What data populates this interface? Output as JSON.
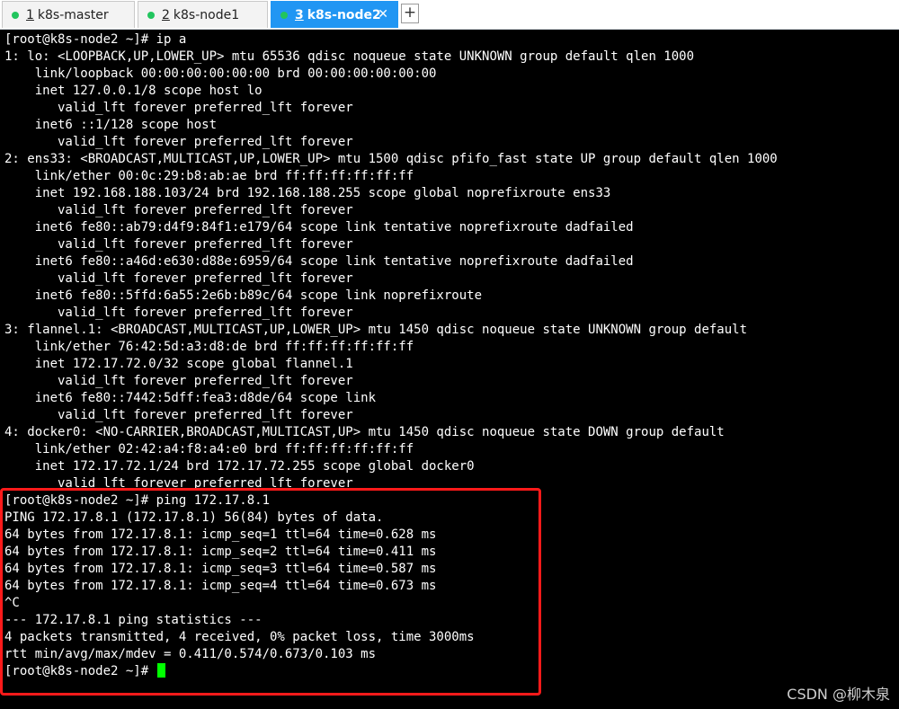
{
  "tabs": [
    {
      "number": "1",
      "label": "k8s-master",
      "active": false
    },
    {
      "number": "2",
      "label": "k8s-node1",
      "active": false
    },
    {
      "number": "3",
      "label": "k8s-node2",
      "active": true
    }
  ],
  "tab_close_glyph": "✕",
  "new_tab_glyph": "+",
  "terminal_lines": [
    "[root@k8s-node2 ~]# ip a",
    "1: lo: <LOOPBACK,UP,LOWER_UP> mtu 65536 qdisc noqueue state UNKNOWN group default qlen 1000",
    "    link/loopback 00:00:00:00:00:00 brd 00:00:00:00:00:00",
    "    inet 127.0.0.1/8 scope host lo",
    "       valid_lft forever preferred_lft forever",
    "    inet6 ::1/128 scope host",
    "       valid_lft forever preferred_lft forever",
    "2: ens33: <BROADCAST,MULTICAST,UP,LOWER_UP> mtu 1500 qdisc pfifo_fast state UP group default qlen 1000",
    "    link/ether 00:0c:29:b8:ab:ae brd ff:ff:ff:ff:ff:ff",
    "    inet 192.168.188.103/24 brd 192.168.188.255 scope global noprefixroute ens33",
    "       valid_lft forever preferred_lft forever",
    "    inet6 fe80::ab79:d4f9:84f1:e179/64 scope link tentative noprefixroute dadfailed",
    "       valid_lft forever preferred_lft forever",
    "    inet6 fe80::a46d:e630:d88e:6959/64 scope link tentative noprefixroute dadfailed",
    "       valid_lft forever preferred_lft forever",
    "    inet6 fe80::5ffd:6a55:2e6b:b89c/64 scope link noprefixroute",
    "       valid_lft forever preferred_lft forever",
    "3: flannel.1: <BROADCAST,MULTICAST,UP,LOWER_UP> mtu 1450 qdisc noqueue state UNKNOWN group default",
    "    link/ether 76:42:5d:a3:d8:de brd ff:ff:ff:ff:ff:ff",
    "    inet 172.17.72.0/32 scope global flannel.1",
    "       valid_lft forever preferred_lft forever",
    "    inet6 fe80::7442:5dff:fea3:d8de/64 scope link",
    "       valid_lft forever preferred_lft forever",
    "4: docker0: <NO-CARRIER,BROADCAST,MULTICAST,UP> mtu 1450 qdisc noqueue state DOWN group default",
    "    link/ether 02:42:a4:f8:a4:e0 brd ff:ff:ff:ff:ff:ff",
    "    inet 172.17.72.1/24 brd 172.17.72.255 scope global docker0",
    "       valid_lft forever preferred_lft forever",
    "[root@k8s-node2 ~]# ping 172.17.8.1",
    "PING 172.17.8.1 (172.17.8.1) 56(84) bytes of data.",
    "64 bytes from 172.17.8.1: icmp_seq=1 ttl=64 time=0.628 ms",
    "64 bytes from 172.17.8.1: icmp_seq=2 ttl=64 time=0.411 ms",
    "64 bytes from 172.17.8.1: icmp_seq=3 ttl=64 time=0.587 ms",
    "64 bytes from 172.17.8.1: icmp_seq=4 ttl=64 time=0.673 ms",
    "^C",
    "--- 172.17.8.1 ping statistics ---",
    "4 packets transmitted, 4 received, 0% packet loss, time 3000ms",
    "rtt min/avg/max/mdev = 0.411/0.574/0.673/0.103 ms"
  ],
  "prompt": "[root@k8s-node2 ~]# ",
  "watermark": "CSDN @柳木泉",
  "colors": {
    "terminal_bg": "#000000",
    "terminal_fg": "#ffffff",
    "active_tab": "#2196f3",
    "status_dot": "#22c55e",
    "cursor": "#00ff00",
    "highlight_border": "#ff1a1a"
  }
}
